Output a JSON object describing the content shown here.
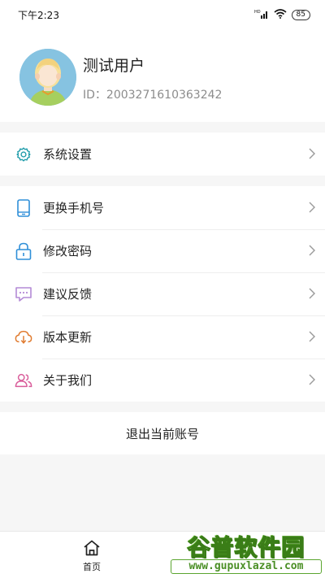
{
  "status_bar": {
    "time": "下午2:23",
    "network": "HD",
    "battery": "85"
  },
  "profile": {
    "name": "测试用户",
    "id_label": "ID：2003271610363242"
  },
  "menu_group1": [
    {
      "label": "系统设置",
      "icon": "gear-icon"
    }
  ],
  "menu_group2": [
    {
      "label": "更换手机号",
      "icon": "phone-icon"
    },
    {
      "label": "修改密码",
      "icon": "lock-icon"
    },
    {
      "label": "建议反馈",
      "icon": "chat-icon"
    },
    {
      "label": "版本更新",
      "icon": "cloud-download-icon"
    },
    {
      "label": "关于我们",
      "icon": "users-icon"
    }
  ],
  "logout": {
    "label": "退出当前账号"
  },
  "bottom_nav": {
    "home_label": "首页"
  },
  "watermark": {
    "brand": "谷普软件园",
    "url": "www.gupuxlazal.com"
  },
  "colors": {
    "teal": "#1a9aa8",
    "blue": "#2f8fd8",
    "purple": "#b48ad6",
    "orange": "#e07a2e",
    "pink": "#d95c9a"
  }
}
